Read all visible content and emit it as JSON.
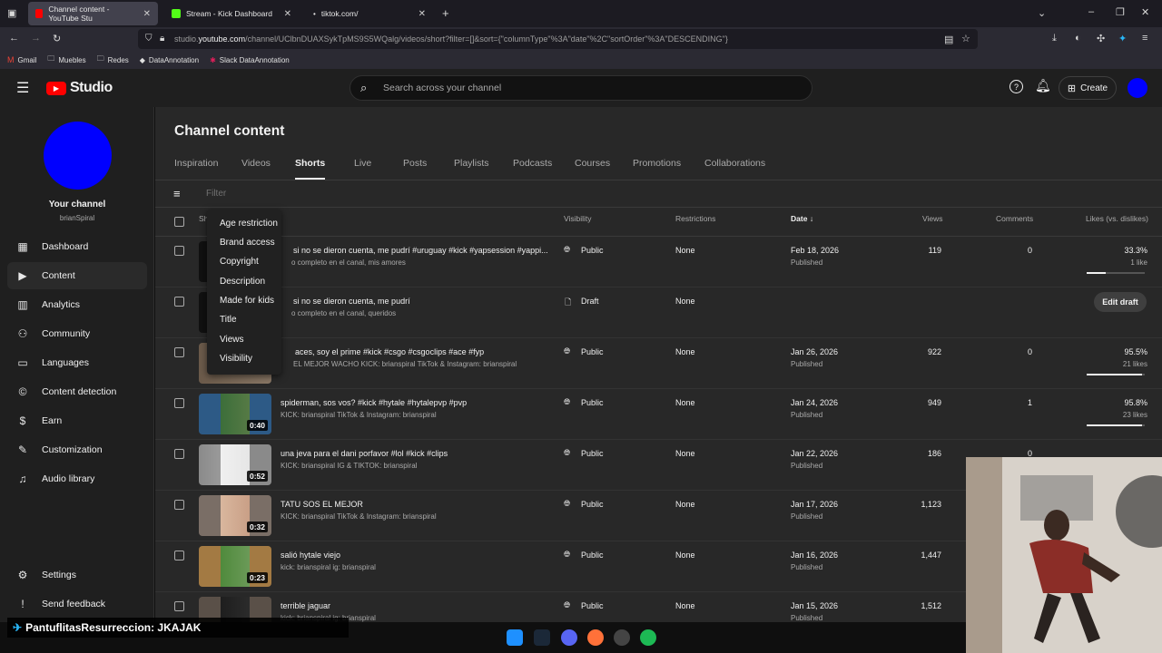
{
  "browser": {
    "tabs": [
      {
        "label": "Channel content - YouTube Stu"
      },
      {
        "label": "Stream - Kick Dashboard"
      },
      {
        "label": "tiktok.com/"
      }
    ],
    "url_prefix": "studio.",
    "url_domain": "youtube.com",
    "url_path": "/channel/UClbnDUAXSykTpMS9S5WQalg/videos/short?filter=[]&sort={\"columnType\"%3A\"date\"%2C\"sortOrder\"%3A\"DESCENDING\"}",
    "bookmarks": [
      "Gmail",
      "Muebles",
      "Redes",
      "DataAnnotation",
      "Slack DataAnnotation"
    ]
  },
  "header": {
    "logo_text": "Studio",
    "search_placeholder": "Search across your channel",
    "create_label": "Create"
  },
  "sidebar": {
    "channel_title": "Your channel",
    "channel_handle": "brianSpiral",
    "items": [
      {
        "label": "Dashboard",
        "icon": "dashboard-icon"
      },
      {
        "label": "Content",
        "icon": "content-icon"
      },
      {
        "label": "Analytics",
        "icon": "analytics-icon"
      },
      {
        "label": "Community",
        "icon": "community-icon"
      },
      {
        "label": "Languages",
        "icon": "languages-icon"
      },
      {
        "label": "Content detection",
        "icon": "copyright-icon"
      },
      {
        "label": "Earn",
        "icon": "earn-icon"
      },
      {
        "label": "Customization",
        "icon": "customization-icon"
      },
      {
        "label": "Audio library",
        "icon": "audio-library-icon"
      }
    ],
    "settings_label": "Settings",
    "feedback_label": "Send feedback"
  },
  "main": {
    "title": "Channel content",
    "tabs": [
      "Inspiration",
      "Videos",
      "Shorts",
      "Live",
      "Posts",
      "Playlists",
      "Podcasts",
      "Courses",
      "Promotions",
      "Collaborations"
    ],
    "active_tab": "Shorts",
    "filter_placeholder": "Filter",
    "columns": {
      "short": "Sh",
      "visibility": "Visibility",
      "restrictions": "Restrictions",
      "date": "Date",
      "views": "Views",
      "comments": "Comments",
      "likes": "Likes (vs. dislikes)"
    },
    "filter_menu": [
      "Age restriction",
      "Brand access",
      "Copyright",
      "Description",
      "Made for kids",
      "Title",
      "Views",
      "Visibility"
    ],
    "rows": [
      {
        "title": "si no se dieron cuenta, me pudrí #uruguay #kick #yapsession #yappi...",
        "desc": "o completo en el canal, mis amores",
        "duration": "",
        "visibility": "Public",
        "restrictions": "None",
        "date": "Feb 18, 2026",
        "status": "Published",
        "views": "119",
        "comments": "0",
        "likes_pct": "33.3%",
        "likes_count": "1 like",
        "like_ratio": 0.333
      },
      {
        "title": "si no se dieron cuenta, me pudrí",
        "desc": "o completo en el canal, queridos",
        "duration": "",
        "visibility": "Draft",
        "restrictions": "None",
        "date": "",
        "status": "",
        "views": "",
        "comments": "",
        "likes_pct": "",
        "likes_count": "",
        "edit_label": "Edit draft"
      },
      {
        "title": "aces, soy el prime #kick #csgo #csgoclips #ace #fyp",
        "desc": "EL MEJOR WACHO KICK: brianspiral TikTok & Instagram: brianspiral",
        "duration": "",
        "visibility": "Public",
        "restrictions": "None",
        "date": "Jan 26, 2026",
        "status": "Published",
        "views": "922",
        "comments": "0",
        "likes_pct": "95.5%",
        "likes_count": "21 likes",
        "like_ratio": 0.955
      },
      {
        "title": "spiderman, sos vos? #kick #hytale #hytalepvp #pvp",
        "desc": "KICK: brianspiral TikTok & Instagram: brianspiral",
        "duration": "0:40",
        "visibility": "Public",
        "restrictions": "None",
        "date": "Jan 24, 2026",
        "status": "Published",
        "views": "949",
        "comments": "1",
        "likes_pct": "95.8%",
        "likes_count": "23 likes",
        "like_ratio": 0.958
      },
      {
        "title": "una jeva para el dani porfavor #lol #kick #clips",
        "desc": "KICK: brianspiral IG & TIKTOK: brianspiral",
        "duration": "0:52",
        "visibility": "Public",
        "restrictions": "None",
        "date": "Jan 22, 2026",
        "status": "Published",
        "views": "186",
        "comments": "0",
        "likes_pct": "",
        "likes_count": ""
      },
      {
        "title": "TATU SOS EL MEJOR",
        "desc": "KICK: brianspiral TikTok & Instagram: brianspiral",
        "duration": "0:32",
        "visibility": "Public",
        "restrictions": "None",
        "date": "Jan 17, 2026",
        "status": "Published",
        "views": "1,123",
        "comments": "",
        "likes_pct": "",
        "likes_count": ""
      },
      {
        "title": "salió hytale viejo",
        "desc": "kick: brianspiral ig: brianspiral",
        "duration": "0:23",
        "visibility": "Public",
        "restrictions": "None",
        "date": "Jan 16, 2026",
        "status": "Published",
        "views": "1,447",
        "comments": "",
        "likes_pct": "",
        "likes_count": ""
      },
      {
        "title": "terrible jaguar",
        "desc": "kick: brianspiral ig: brianspiral",
        "duration": "",
        "visibility": "Public",
        "restrictions": "None",
        "date": "Jan 15, 2026",
        "status": "Published",
        "views": "1,512",
        "comments": "",
        "likes_pct": "",
        "likes_count": ""
      }
    ]
  },
  "overlay": {
    "streamer_text": "PantuflitasResurreccion: JKAJAK"
  },
  "colors": {
    "brand_red": "#ff0000",
    "avatar_blue": "#0000ff",
    "kick_green": "#53fc18"
  }
}
